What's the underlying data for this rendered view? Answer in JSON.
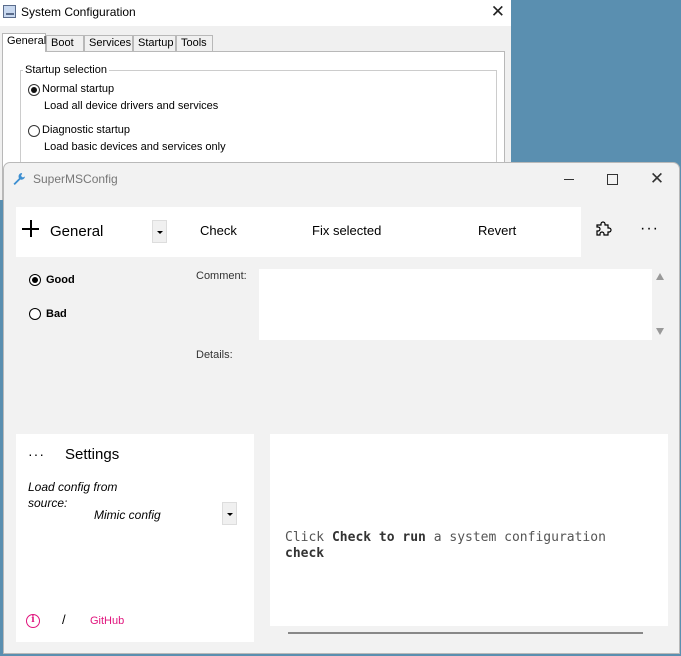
{
  "bg_window": {
    "title": "System Configuration",
    "close": "✕",
    "tabs": [
      "General",
      "Boot",
      "Services",
      "Startup",
      "Tools"
    ],
    "active_tab": "General",
    "group_title": "Startup selection",
    "options": [
      {
        "label": "Normal startup",
        "desc": "Load all device drivers and services",
        "selected": true
      },
      {
        "label": "Diagnostic startup",
        "desc": "Load basic devices and services only",
        "selected": false
      }
    ]
  },
  "window": {
    "title": "SuperMSConfig",
    "close": "✕"
  },
  "cmdbar": {
    "category": "General",
    "check": "Check",
    "fix": "Fix selected",
    "revert": "Revert",
    "more": "···"
  },
  "evaluation": {
    "good": "Good",
    "bad": "Bad",
    "selected": "Good",
    "comment_label": "Comment:",
    "details_label": "Details:",
    "comment_value": ""
  },
  "settings": {
    "more": "···",
    "title": "Settings",
    "source_label": "Load config from source:",
    "source_value": "Mimic config",
    "info": "i",
    "separator": "/",
    "github": "GitHub"
  },
  "output": {
    "parts": [
      "Click ",
      "Check to run",
      " a system configuration ",
      "check"
    ]
  },
  "colors": {
    "accent": "#e0147d",
    "window_bg": "#f2f2f2",
    "panel_bg": "#ffffff"
  }
}
